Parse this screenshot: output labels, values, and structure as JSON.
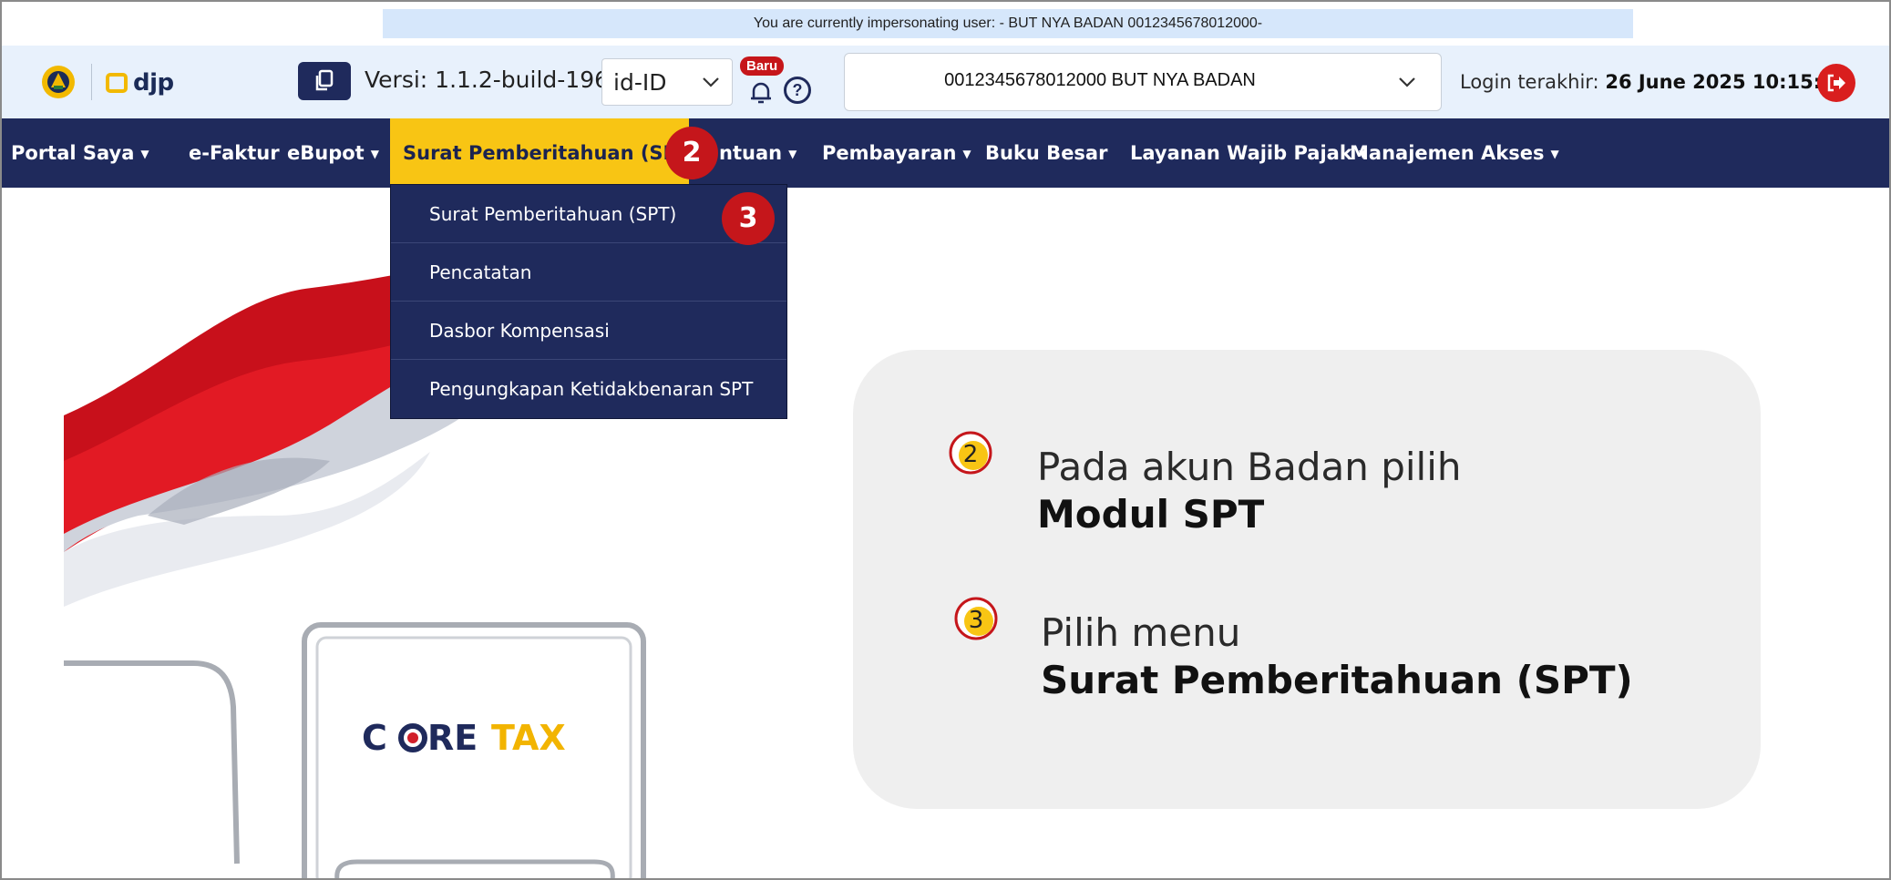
{
  "banner": {
    "text": "You are currently impersonating user: - BUT NYA BADAN 0012345678012000-"
  },
  "header": {
    "logo_text": "djp",
    "version_label": "Versi: 1.1.2-build-1966",
    "language": "id-ID",
    "new_badge": "Baru",
    "help_symbol": "?",
    "account_selected": "0012345678012000 BUT NYA BADAN",
    "login_label": "Login terakhir:",
    "login_time": "26 June 2025 10:15:58"
  },
  "nav": {
    "items": [
      {
        "label": "Portal Saya"
      },
      {
        "label": "e-Faktur"
      },
      {
        "label": "eBupot"
      },
      {
        "label": "Surat Pemberitahuan (SPT)"
      },
      {
        "label": "Bantuan"
      },
      {
        "label": "Pembayaran"
      },
      {
        "label": "Buku Besar"
      },
      {
        "label": "Layanan Wajib Pajak"
      },
      {
        "label": "Manajemen Akses"
      }
    ],
    "visible_partial_label": "ntuan"
  },
  "dropdown": {
    "items": [
      {
        "label": "Surat Pemberitahuan (SPT)"
      },
      {
        "label": "Pencatatan"
      },
      {
        "label": "Dasbor Kompensasi"
      },
      {
        "label": "Pengungkapan Ketidakbenaran SPT"
      }
    ]
  },
  "markers": {
    "step2": "2",
    "step3": "3"
  },
  "illustration": {
    "brand_part1": "C",
    "brand_part2": "RE",
    "brand_part3": "TAX"
  },
  "card": {
    "step2_num": "2",
    "step2_line1": "Pada akun Badan pilih",
    "step2_line2": "Modul SPT",
    "step3_num": "3",
    "step3_line1": "Pilih menu",
    "step3_line2": "Surat Pemberitahuan (SPT)"
  },
  "colors": {
    "navy": "#1f2a5c",
    "accent_yellow": "#f8c514",
    "marker_red": "#c5161b",
    "header_bg": "#e8f1fc",
    "banner_bg": "#d6e7fb"
  }
}
